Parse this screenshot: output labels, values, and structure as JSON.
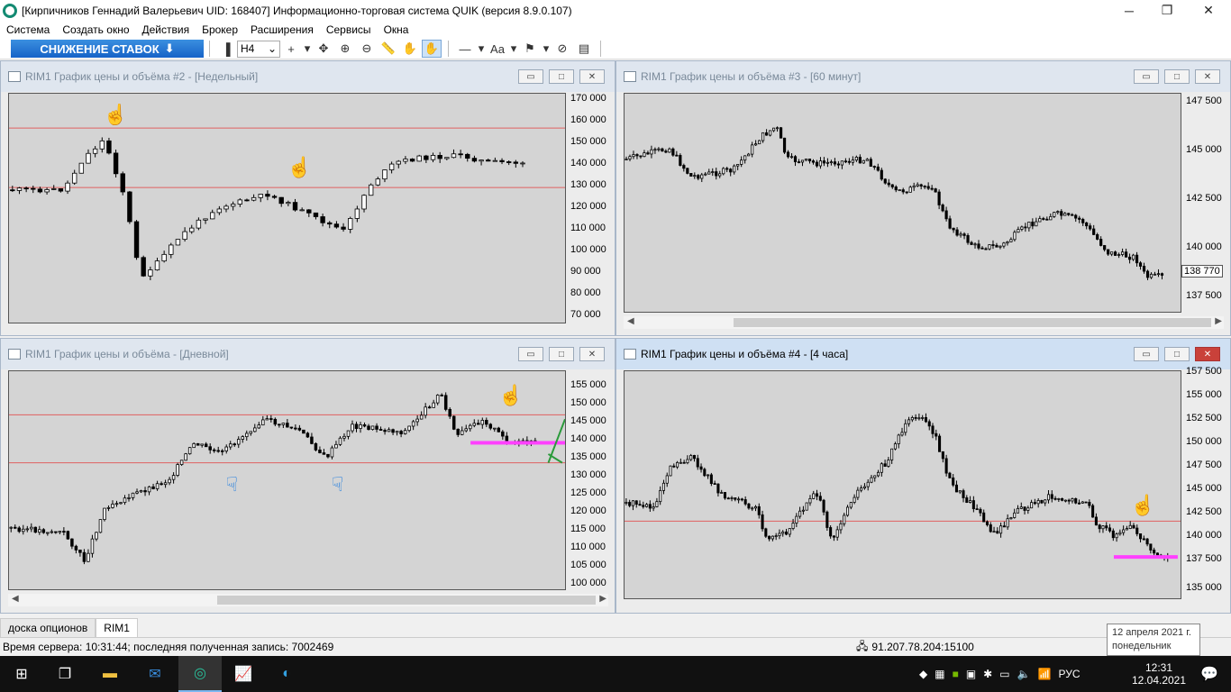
{
  "window": {
    "title": "[Кирпичников Геннадий Валерьевич UID: 168407] Информационно-торговая система QUIK (версия 8.9.0.107)",
    "minimize": "─",
    "restore": "❐",
    "close": "✕"
  },
  "menu": [
    "Система",
    "Создать окно",
    "Действия",
    "Брокер",
    "Расширения",
    "Сервисы",
    "Окна"
  ],
  "toolbar": {
    "banner": "СНИЖЕНИЕ СТАВОК",
    "timeframe": "H4",
    "font_label": "Aa"
  },
  "charts": [
    {
      "title": "RIM1 График цены и объёма #2 - [Недельный]",
      "yticks": [
        "170 000",
        "160 000",
        "150 000",
        "140 000",
        "130 000",
        "120 000",
        "110 000",
        "100 000",
        "90 000",
        "80 000",
        "70 000"
      ]
    },
    {
      "title": "RIM1 График цены и объёма #3 - [60 минут]",
      "yticks": [
        "147 500",
        "145 000",
        "142 500",
        "140 000",
        "137 500"
      ],
      "last_price": "138 770"
    },
    {
      "title": "RIM1 График цены и объёма - [Дневной]",
      "yticks": [
        "155 000",
        "150 000",
        "145 000",
        "140 000",
        "135 000",
        "130 000",
        "125 000",
        "120 000",
        "115 000",
        "110 000",
        "105 000",
        "100 000"
      ]
    },
    {
      "title": "RIM1 График цены и объёма #4 - [4 часа]",
      "yticks": [
        "157 500",
        "155 000",
        "152 500",
        "150 000",
        "147 500",
        "145 000",
        "142 500",
        "140 000",
        "137 500",
        "135 000"
      ]
    }
  ],
  "tabs": [
    "доска опционов",
    "RIM1"
  ],
  "status": {
    "server_time": "Время сервера: 10:31:44; последняя полученная запись: 7002469",
    "connection": "91.207.78.204:15100"
  },
  "tooltip": {
    "line1": "12 апреля 2021 г.",
    "line2": "понедельник"
  },
  "tray": {
    "lang": "РУС",
    "time": "12:31",
    "date": "12.04.2021"
  }
}
